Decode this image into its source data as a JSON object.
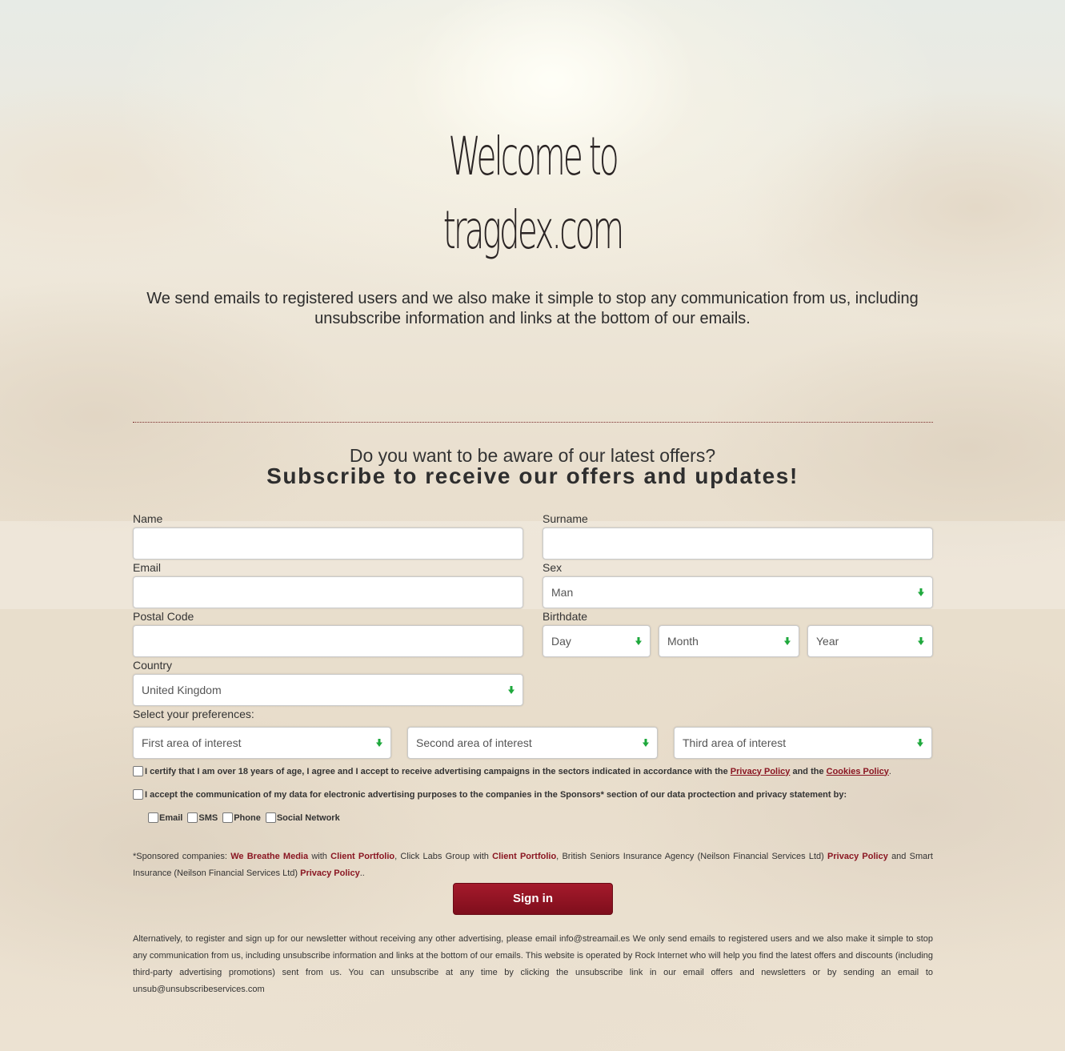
{
  "hero": {
    "line1": "Welcome to",
    "line2": "tragdex.com",
    "intro": "We send emails to registered users and we also make it simple to stop any communication from us, including unsubscribe information and links at the bottom of our emails."
  },
  "subscribe": {
    "question": "Do you want to be aware of our latest offers?",
    "headline": "Subscribe to receive our offers and updates!"
  },
  "form": {
    "name_label": "Name",
    "name_value": "",
    "surname_label": "Surname",
    "surname_value": "",
    "email_label": "Email",
    "email_value": "",
    "sex_label": "Sex",
    "sex_value": "Man",
    "postal_label": "Postal Code",
    "postal_value": "",
    "birthdate_label": "Birthdate",
    "day_value": "Day",
    "month_value": "Month",
    "year_value": "Year",
    "country_label": "Country",
    "country_value": "United Kingdom",
    "preferences_label": "Select your preferences:",
    "interest1": "First area of interest",
    "interest2": "Second area of interest",
    "interest3": "Third area of interest",
    "consent1_text": "I certify that I am over 18 years of age, I agree and I accept to receive advertising campaigns in the sectors indicated in accordance with the",
    "privacy_link": "Privacy Policy",
    "consent1_and": "and the",
    "cookies_link": "Cookies Policy",
    "consent1_end": ".",
    "consent2_text": "I accept the communication of my data for electronic advertising purposes to the companies in the Sponsors* section of our data proctection and privacy statement by:",
    "channels": [
      "Email",
      "SMS",
      "Phone",
      "Social Network"
    ],
    "submit": "Sign in"
  },
  "sponsors": {
    "prefix": "*Sponsored companies:",
    "c1": "We Breathe Media",
    "with1": "with",
    "cp1": "Client Portfolio",
    "mid1": ", Click Labs Group with",
    "cp2": "Client Portfolio",
    "mid2": ", British Seniors Insurance Agency (Neilson Financial Services Ltd)",
    "pp1": "Privacy Policy",
    "mid3": "and Smart Insurance (Neilson Financial Services Ltd)",
    "pp2": "Privacy Policy",
    "end": ".."
  },
  "footer": {
    "text": "Alternatively, to register and sign up for our newsletter without receiving any other advertising, please email info@streamail.es We only send emails to registered users and we also make it simple to stop any communication from us, including unsubscribe information and links at the bottom of our emails. This website is operated by Rock Internet who will help you find the latest offers and discounts (including third-party advertising promotions) sent from us. You can unsubscribe at any time by clicking the unsubscribe link in our email offers and newsletters or by sending an email to unsub@unsubscribeservices.com"
  },
  "colors": {
    "accent": "#8a1622",
    "button": "#951526",
    "arrow": "#1ea83c"
  },
  "icons": {
    "select_arrow": "green-down-arrow-icon"
  }
}
